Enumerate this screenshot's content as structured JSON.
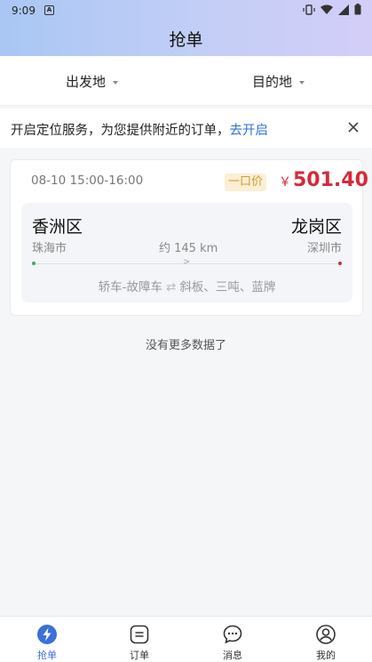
{
  "status": {
    "time": "9:09",
    "notif_glyph": "A"
  },
  "header": {
    "title": "抢单"
  },
  "filters": {
    "origin": "出发地",
    "destination": "目的地"
  },
  "location_banner": {
    "message": "开启定位服务，为您提供附近的订单，",
    "link": "去开启"
  },
  "orders": [
    {
      "time_window": "08-10 15:00-16:00",
      "price_tag": "一口价",
      "currency": "￥",
      "price": "501.40",
      "from_district": "香洲区",
      "from_city": "珠海市",
      "to_district": "龙岗区",
      "to_city": "深圳市",
      "distance": "约 145 km",
      "cargo": "轿车-故障车",
      "requirements": "斜板、三吨、蓝牌"
    }
  ],
  "list_footer": "没有更多数据了",
  "tabs": [
    {
      "label": "抢单",
      "icon": "lightning-icon",
      "active": true
    },
    {
      "label": "订单",
      "icon": "order-list-icon",
      "active": false
    },
    {
      "label": "消息",
      "icon": "chat-bubble-icon",
      "active": false
    },
    {
      "label": "我的",
      "icon": "user-profile-icon",
      "active": false
    }
  ],
  "colors": {
    "accent": "#3b6fd9",
    "price": "#d42a3a",
    "link": "#2f6fd8",
    "tag_bg": "#fbefd6",
    "tag_text": "#d99a2a"
  }
}
